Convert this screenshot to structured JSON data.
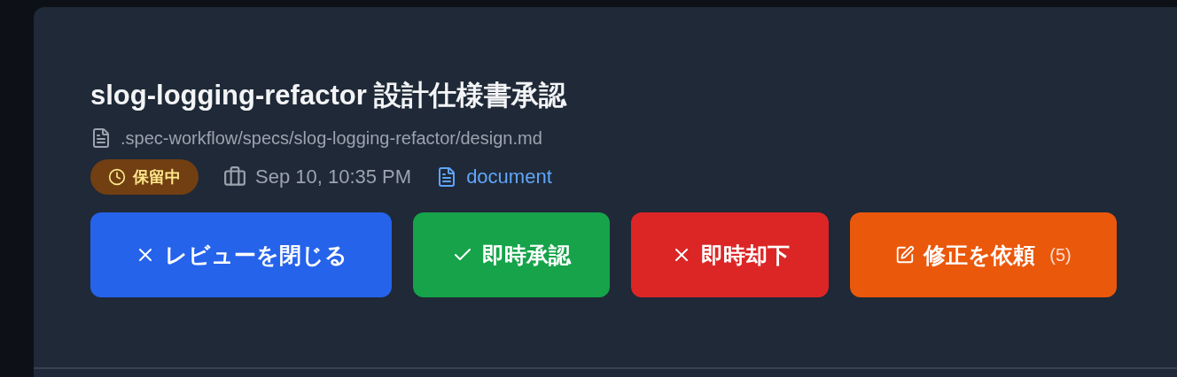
{
  "title": "slog-logging-refactor 設計仕様書承認",
  "path": ".spec-workflow/specs/slog-logging-refactor/design.md",
  "status": {
    "label": "保留中",
    "kind": "pending"
  },
  "date": "Sep 10, 10:35 PM",
  "doc_type": "document",
  "buttons": [
    {
      "kind": "close",
      "label": "レビューを閉じる"
    },
    {
      "kind": "approve",
      "label": "即時承認"
    },
    {
      "kind": "reject",
      "label": "即時却下"
    },
    {
      "kind": "revise",
      "label": "修正を依頼",
      "count": "(5)"
    }
  ]
}
